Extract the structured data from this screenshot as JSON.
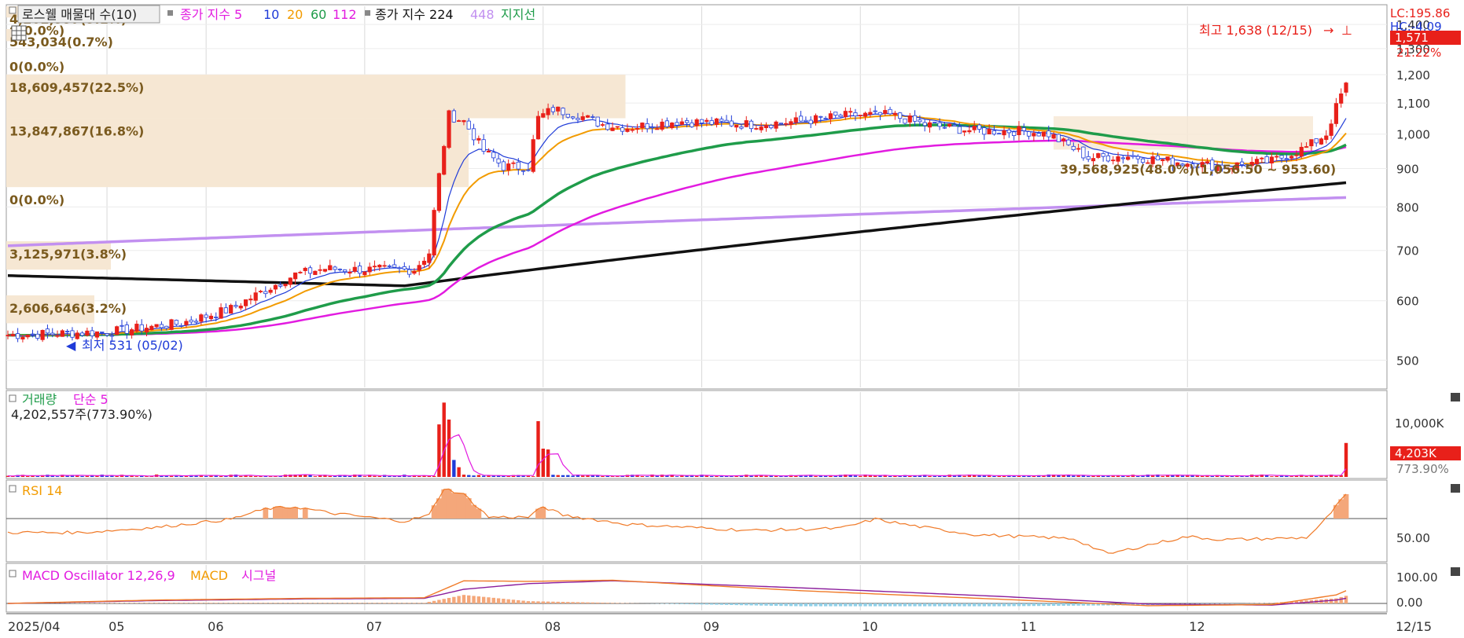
{
  "legend": {
    "toggle_label": "로스웰 매물대 수(10)",
    "ma_label": "종가 지수 5",
    "ma_periods": [
      {
        "text": "10",
        "color": "#1f3bd8"
      },
      {
        "text": "20",
        "color": "#f29b00"
      },
      {
        "text": "60",
        "color": "#1f9c4a"
      },
      {
        "text": "112",
        "color": "#e21be0"
      }
    ],
    "ma224_label": "종가 지수 224",
    "ma448_label": "448",
    "support_label": "지지선"
  },
  "price_panel": {
    "high_marker": "최고 1,638 (12/15)",
    "low_marker": "최저 531 (05/02)",
    "lc_text": "LC:195.86",
    "hc_text": "HC:-4.09",
    "last_price_tag": "1,571",
    "last_pct": "21.22%",
    "y_ticks": [
      "1,400",
      "1,300",
      "1,200",
      "1,100",
      "1,000",
      "900",
      "800",
      "700",
      "600",
      "500"
    ],
    "volume_profile": [
      {
        "label": "4,202,557(5.1%)",
        "price_lo": 1430,
        "price_hi": 1480,
        "share": 0.051
      },
      {
        "label": "0(0.0%)",
        "price_lo": 1380,
        "price_hi": 1430,
        "share": 0
      },
      {
        "label": "543,034(0.7%)",
        "price_lo": 1330,
        "price_hi": 1380,
        "share": 0.007
      },
      {
        "label": "0(0.0%)",
        "price_lo": 1200,
        "price_hi": 1280,
        "share": 0
      },
      {
        "label": "18,609,457(22.5%)",
        "price_lo": 1050,
        "price_hi": 1200,
        "share": 0.225
      },
      {
        "label": "13,847,867(16.8%)",
        "price_lo": 850,
        "price_hi": 1050,
        "share": 0.168
      },
      {
        "label": "0(0.0%)",
        "price_lo": 780,
        "price_hi": 850,
        "share": 0
      },
      {
        "label": "3,125,971(3.8%)",
        "price_lo": 660,
        "price_hi": 720,
        "share": 0.038
      },
      {
        "label": "2,606,646(3.2%)",
        "price_lo": 560,
        "price_hi": 610,
        "share": 0.032
      }
    ],
    "range_label": "39,568,925(48.0%)(1,056.50 ~ 953.60)"
  },
  "volume_panel": {
    "title": "거래량",
    "ma_label": "단순 5",
    "summary": "4,202,557주(773.90%)",
    "y_tick": "10,000K",
    "last_tag": "4,203K",
    "last_pct": "773.90%"
  },
  "rsi_panel": {
    "title": "RSI 14",
    "y_tick": "50.00"
  },
  "macd_panel": {
    "osc_label": "MACD Oscillator 12,26,9",
    "macd_label": "MACD",
    "signal_label": "시그널",
    "y_ticks": [
      "100.00",
      "0.00"
    ]
  },
  "x_axis": {
    "labels": [
      "2025/04",
      "05",
      "06",
      "07",
      "08",
      "09",
      "10",
      "11",
      "12"
    ],
    "last_label": "12/15"
  },
  "colors": {
    "up": "#e8201a",
    "down": "#1f3bd8",
    "ma5": "#1f3bd8",
    "ma20": "#f29b00",
    "ma60": "#1f9c4a",
    "ma112": "#e21be0",
    "ma224": "#111111",
    "ma448": "#c290f0",
    "profile": "#f6e7d3",
    "profile_text": "#7a5a1e"
  },
  "chart_data": {
    "type": "candlestick",
    "x_range": [
      "2025/04",
      "12/15"
    ],
    "ylim": [
      460,
      1480
    ],
    "months": [
      "2025/04",
      "05",
      "06",
      "07",
      "08",
      "09",
      "10",
      "11",
      "12"
    ],
    "anchors": [
      {
        "day": 0,
        "close": 540
      },
      {
        "day": 20,
        "close": 545
      },
      {
        "day": 35,
        "close": 560
      },
      {
        "day": 45,
        "close": 585
      },
      {
        "day": 52,
        "close": 620
      },
      {
        "day": 58,
        "close": 650
      },
      {
        "day": 64,
        "close": 662
      },
      {
        "day": 70,
        "close": 660
      },
      {
        "day": 75,
        "close": 660
      },
      {
        "day": 82,
        "close": 660
      },
      {
        "day": 85,
        "close": 695
      },
      {
        "day": 87,
        "close": 880
      },
      {
        "day": 89,
        "close": 1060
      },
      {
        "day": 92,
        "close": 1040
      },
      {
        "day": 96,
        "close": 950
      },
      {
        "day": 100,
        "close": 905
      },
      {
        "day": 105,
        "close": 905
      },
      {
        "day": 107,
        "close": 1050
      },
      {
        "day": 110,
        "close": 1080
      },
      {
        "day": 115,
        "close": 1060
      },
      {
        "day": 120,
        "close": 1030
      },
      {
        "day": 125,
        "close": 1020
      },
      {
        "day": 135,
        "close": 1040
      },
      {
        "day": 150,
        "close": 1030
      },
      {
        "day": 160,
        "close": 1040
      },
      {
        "day": 170,
        "close": 1060
      },
      {
        "day": 178,
        "close": 1060
      },
      {
        "day": 185,
        "close": 1030
      },
      {
        "day": 195,
        "close": 1010
      },
      {
        "day": 205,
        "close": 1010
      },
      {
        "day": 210,
        "close": 1000
      },
      {
        "day": 218,
        "close": 930
      },
      {
        "day": 226,
        "close": 935
      },
      {
        "day": 235,
        "close": 920
      },
      {
        "day": 245,
        "close": 905
      },
      {
        "day": 255,
        "close": 920
      },
      {
        "day": 262,
        "close": 960
      },
      {
        "day": 266,
        "close": 1000
      },
      {
        "day": 270,
        "close": 1170
      }
    ],
    "volume_spikes": [
      {
        "day": 87,
        "vol": 6500
      },
      {
        "day": 88,
        "vol": 9200
      },
      {
        "day": 89,
        "vol": 7100
      },
      {
        "day": 90,
        "vol": 2100
      },
      {
        "day": 91,
        "vol": 1200
      },
      {
        "day": 107,
        "vol": 6900
      },
      {
        "day": 108,
        "vol": 3500
      },
      {
        "day": 109,
        "vol": 3400
      },
      {
        "day": 270,
        "vol": 4203
      }
    ],
    "rsi_anchors": [
      {
        "day": 0,
        "v": 47
      },
      {
        "day": 15,
        "v": 47
      },
      {
        "day": 30,
        "v": 52
      },
      {
        "day": 45,
        "v": 60
      },
      {
        "day": 52,
        "v": 70
      },
      {
        "day": 58,
        "v": 72
      },
      {
        "day": 65,
        "v": 66
      },
      {
        "day": 80,
        "v": 58
      },
      {
        "day": 85,
        "v": 64
      },
      {
        "day": 88,
        "v": 90
      },
      {
        "day": 92,
        "v": 84
      },
      {
        "day": 97,
        "v": 62
      },
      {
        "day": 105,
        "v": 62
      },
      {
        "day": 108,
        "v": 72
      },
      {
        "day": 112,
        "v": 64
      },
      {
        "day": 125,
        "v": 55
      },
      {
        "day": 150,
        "v": 49
      },
      {
        "day": 168,
        "v": 51
      },
      {
        "day": 175,
        "v": 60
      },
      {
        "day": 182,
        "v": 54
      },
      {
        "day": 195,
        "v": 45
      },
      {
        "day": 215,
        "v": 41
      },
      {
        "day": 222,
        "v": 26
      },
      {
        "day": 232,
        "v": 37
      },
      {
        "day": 238,
        "v": 43
      },
      {
        "day": 245,
        "v": 40
      },
      {
        "day": 255,
        "v": 41
      },
      {
        "day": 262,
        "v": 42
      },
      {
        "day": 265,
        "v": 55
      },
      {
        "day": 270,
        "v": 84
      }
    ],
    "macd_anchors": [
      {
        "day": 0,
        "m": 0,
        "s": 0
      },
      {
        "day": 30,
        "m": 12,
        "s": 10
      },
      {
        "day": 60,
        "m": 18,
        "s": 16
      },
      {
        "day": 84,
        "m": 20,
        "s": 18
      },
      {
        "day": 92,
        "m": 80,
        "s": 50
      },
      {
        "day": 105,
        "m": 78,
        "s": 70
      },
      {
        "day": 122,
        "m": 82,
        "s": 80
      },
      {
        "day": 160,
        "m": 45,
        "s": 55
      },
      {
        "day": 200,
        "m": 15,
        "s": 25
      },
      {
        "day": 230,
        "m": -8,
        "s": -2
      },
      {
        "day": 255,
        "m": -4,
        "s": -6
      },
      {
        "day": 268,
        "m": 30,
        "s": 12
      },
      {
        "day": 270,
        "m": 45,
        "s": 18
      }
    ]
  }
}
